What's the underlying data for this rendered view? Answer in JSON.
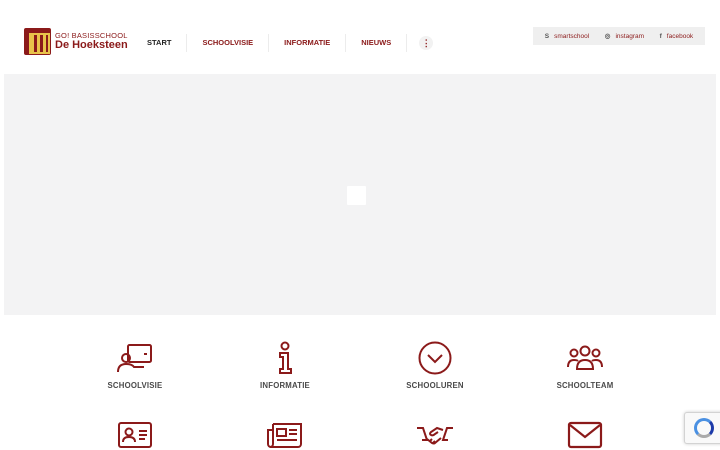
{
  "logo": {
    "top": "GO! BASISSCHOOL",
    "bottom": "De Hoeksteen"
  },
  "nav": {
    "items": [
      "START",
      "SCHOOLVISIE",
      "INFORMATIE",
      "NIEUWS"
    ],
    "more": "⋮"
  },
  "social": [
    {
      "icon": "S",
      "label": "smartschool"
    },
    {
      "icon": "◎",
      "label": "instagram"
    },
    {
      "icon": "f",
      "label": "facebook"
    }
  ],
  "tiles": [
    {
      "label": "SCHOOLVISIE",
      "icon": "presentation-icon"
    },
    {
      "label": "INFORMATIE",
      "icon": "info-icon"
    },
    {
      "label": "SCHOOLUREN",
      "icon": "chevron-circle-icon"
    },
    {
      "label": "SCHOOLTEAM",
      "icon": "team-icon"
    },
    {
      "label": "",
      "icon": "id-card-icon"
    },
    {
      "label": "",
      "icon": "newspaper-icon"
    },
    {
      "label": "",
      "icon": "handshake-icon"
    },
    {
      "label": "",
      "icon": "envelope-icon"
    }
  ],
  "colors": {
    "brand": "#8b1a1a",
    "hero_bg": "#f3f3f4",
    "social_bg": "#efefef"
  }
}
